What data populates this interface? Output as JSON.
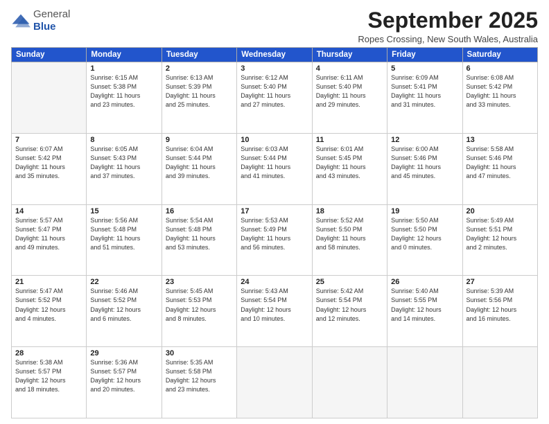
{
  "logo": {
    "general": "General",
    "blue": "Blue"
  },
  "header": {
    "month": "September 2025",
    "location": "Ropes Crossing, New South Wales, Australia"
  },
  "days_of_week": [
    "Sunday",
    "Monday",
    "Tuesday",
    "Wednesday",
    "Thursday",
    "Friday",
    "Saturday"
  ],
  "weeks": [
    [
      {
        "day": "",
        "info": ""
      },
      {
        "day": "1",
        "info": "Sunrise: 6:15 AM\nSunset: 5:38 PM\nDaylight: 11 hours\nand 23 minutes."
      },
      {
        "day": "2",
        "info": "Sunrise: 6:13 AM\nSunset: 5:39 PM\nDaylight: 11 hours\nand 25 minutes."
      },
      {
        "day": "3",
        "info": "Sunrise: 6:12 AM\nSunset: 5:40 PM\nDaylight: 11 hours\nand 27 minutes."
      },
      {
        "day": "4",
        "info": "Sunrise: 6:11 AM\nSunset: 5:40 PM\nDaylight: 11 hours\nand 29 minutes."
      },
      {
        "day": "5",
        "info": "Sunrise: 6:09 AM\nSunset: 5:41 PM\nDaylight: 11 hours\nand 31 minutes."
      },
      {
        "day": "6",
        "info": "Sunrise: 6:08 AM\nSunset: 5:42 PM\nDaylight: 11 hours\nand 33 minutes."
      }
    ],
    [
      {
        "day": "7",
        "info": "Sunrise: 6:07 AM\nSunset: 5:42 PM\nDaylight: 11 hours\nand 35 minutes."
      },
      {
        "day": "8",
        "info": "Sunrise: 6:05 AM\nSunset: 5:43 PM\nDaylight: 11 hours\nand 37 minutes."
      },
      {
        "day": "9",
        "info": "Sunrise: 6:04 AM\nSunset: 5:44 PM\nDaylight: 11 hours\nand 39 minutes."
      },
      {
        "day": "10",
        "info": "Sunrise: 6:03 AM\nSunset: 5:44 PM\nDaylight: 11 hours\nand 41 minutes."
      },
      {
        "day": "11",
        "info": "Sunrise: 6:01 AM\nSunset: 5:45 PM\nDaylight: 11 hours\nand 43 minutes."
      },
      {
        "day": "12",
        "info": "Sunrise: 6:00 AM\nSunset: 5:46 PM\nDaylight: 11 hours\nand 45 minutes."
      },
      {
        "day": "13",
        "info": "Sunrise: 5:58 AM\nSunset: 5:46 PM\nDaylight: 11 hours\nand 47 minutes."
      }
    ],
    [
      {
        "day": "14",
        "info": "Sunrise: 5:57 AM\nSunset: 5:47 PM\nDaylight: 11 hours\nand 49 minutes."
      },
      {
        "day": "15",
        "info": "Sunrise: 5:56 AM\nSunset: 5:48 PM\nDaylight: 11 hours\nand 51 minutes."
      },
      {
        "day": "16",
        "info": "Sunrise: 5:54 AM\nSunset: 5:48 PM\nDaylight: 11 hours\nand 53 minutes."
      },
      {
        "day": "17",
        "info": "Sunrise: 5:53 AM\nSunset: 5:49 PM\nDaylight: 11 hours\nand 56 minutes."
      },
      {
        "day": "18",
        "info": "Sunrise: 5:52 AM\nSunset: 5:50 PM\nDaylight: 11 hours\nand 58 minutes."
      },
      {
        "day": "19",
        "info": "Sunrise: 5:50 AM\nSunset: 5:50 PM\nDaylight: 12 hours\nand 0 minutes."
      },
      {
        "day": "20",
        "info": "Sunrise: 5:49 AM\nSunset: 5:51 PM\nDaylight: 12 hours\nand 2 minutes."
      }
    ],
    [
      {
        "day": "21",
        "info": "Sunrise: 5:47 AM\nSunset: 5:52 PM\nDaylight: 12 hours\nand 4 minutes."
      },
      {
        "day": "22",
        "info": "Sunrise: 5:46 AM\nSunset: 5:52 PM\nDaylight: 12 hours\nand 6 minutes."
      },
      {
        "day": "23",
        "info": "Sunrise: 5:45 AM\nSunset: 5:53 PM\nDaylight: 12 hours\nand 8 minutes."
      },
      {
        "day": "24",
        "info": "Sunrise: 5:43 AM\nSunset: 5:54 PM\nDaylight: 12 hours\nand 10 minutes."
      },
      {
        "day": "25",
        "info": "Sunrise: 5:42 AM\nSunset: 5:54 PM\nDaylight: 12 hours\nand 12 minutes."
      },
      {
        "day": "26",
        "info": "Sunrise: 5:40 AM\nSunset: 5:55 PM\nDaylight: 12 hours\nand 14 minutes."
      },
      {
        "day": "27",
        "info": "Sunrise: 5:39 AM\nSunset: 5:56 PM\nDaylight: 12 hours\nand 16 minutes."
      }
    ],
    [
      {
        "day": "28",
        "info": "Sunrise: 5:38 AM\nSunset: 5:57 PM\nDaylight: 12 hours\nand 18 minutes."
      },
      {
        "day": "29",
        "info": "Sunrise: 5:36 AM\nSunset: 5:57 PM\nDaylight: 12 hours\nand 20 minutes."
      },
      {
        "day": "30",
        "info": "Sunrise: 5:35 AM\nSunset: 5:58 PM\nDaylight: 12 hours\nand 23 minutes."
      },
      {
        "day": "",
        "info": ""
      },
      {
        "day": "",
        "info": ""
      },
      {
        "day": "",
        "info": ""
      },
      {
        "day": "",
        "info": ""
      }
    ]
  ]
}
